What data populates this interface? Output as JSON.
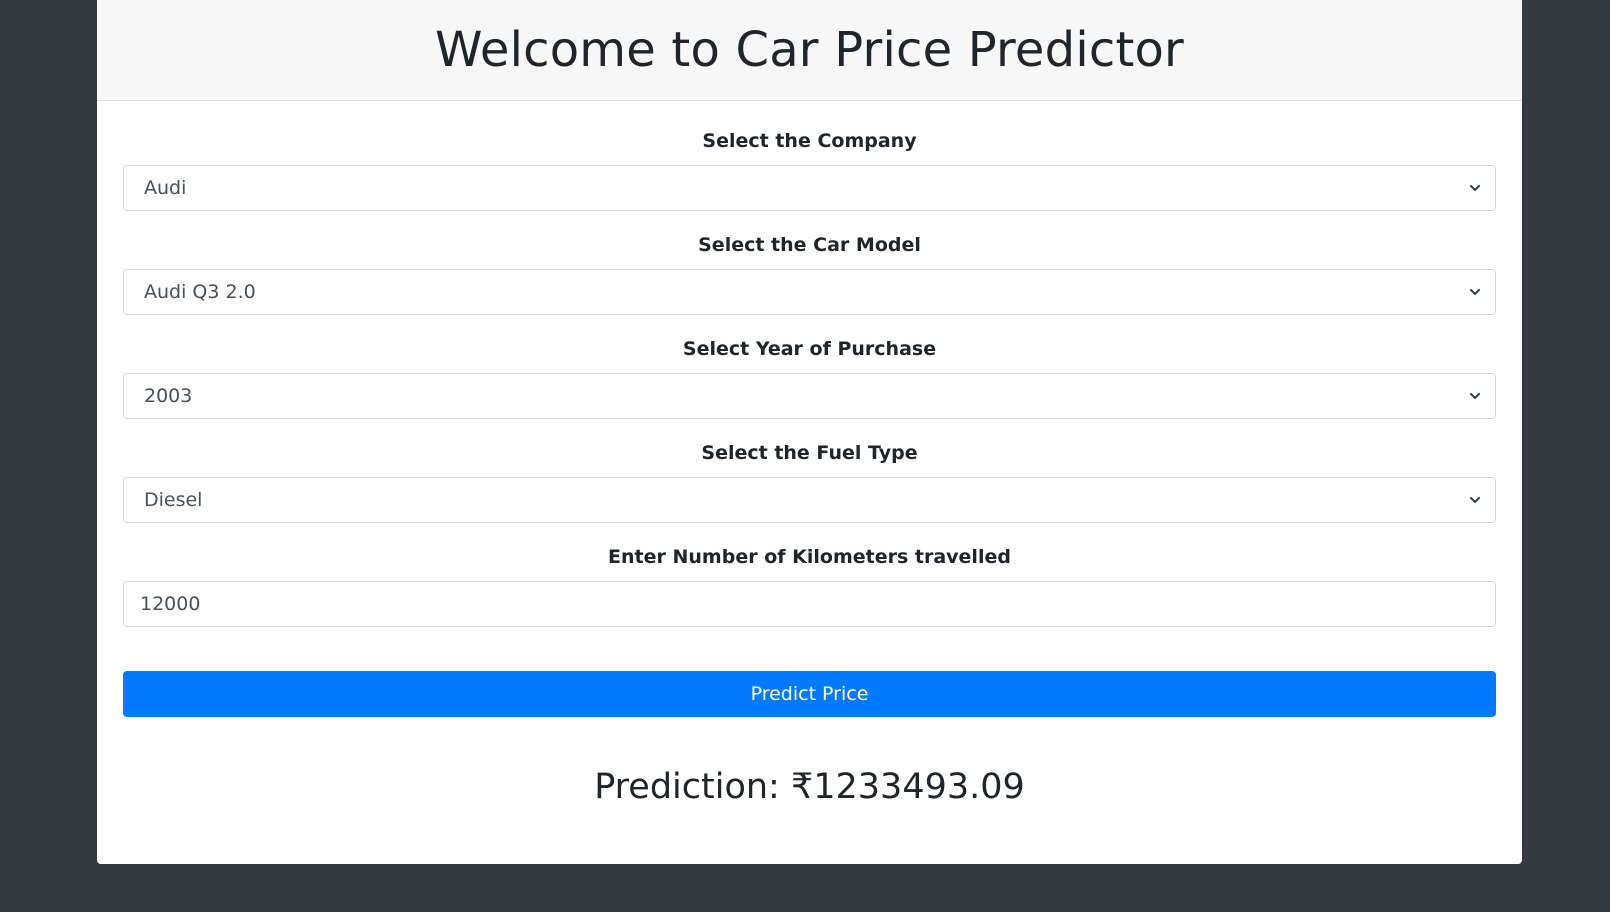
{
  "header": {
    "title": "Welcome to Car Price Predictor"
  },
  "form": {
    "company": {
      "label": "Select the Company",
      "value": "Audi"
    },
    "car_model": {
      "label": "Select the Car Model",
      "value": "Audi Q3 2.0"
    },
    "year": {
      "label": "Select Year of Purchase",
      "value": "2003"
    },
    "fuel_type": {
      "label": "Select the Fuel Type",
      "value": "Diesel"
    },
    "kilometers": {
      "label": "Enter Number of Kilometers travelled",
      "value": "12000"
    },
    "submit_label": "Predict Price"
  },
  "result": {
    "text": "Prediction: ₹1233493.09"
  },
  "colors": {
    "page_background": "#343a40",
    "primary_button": "#007bff",
    "header_background": "#f7f7f7"
  }
}
